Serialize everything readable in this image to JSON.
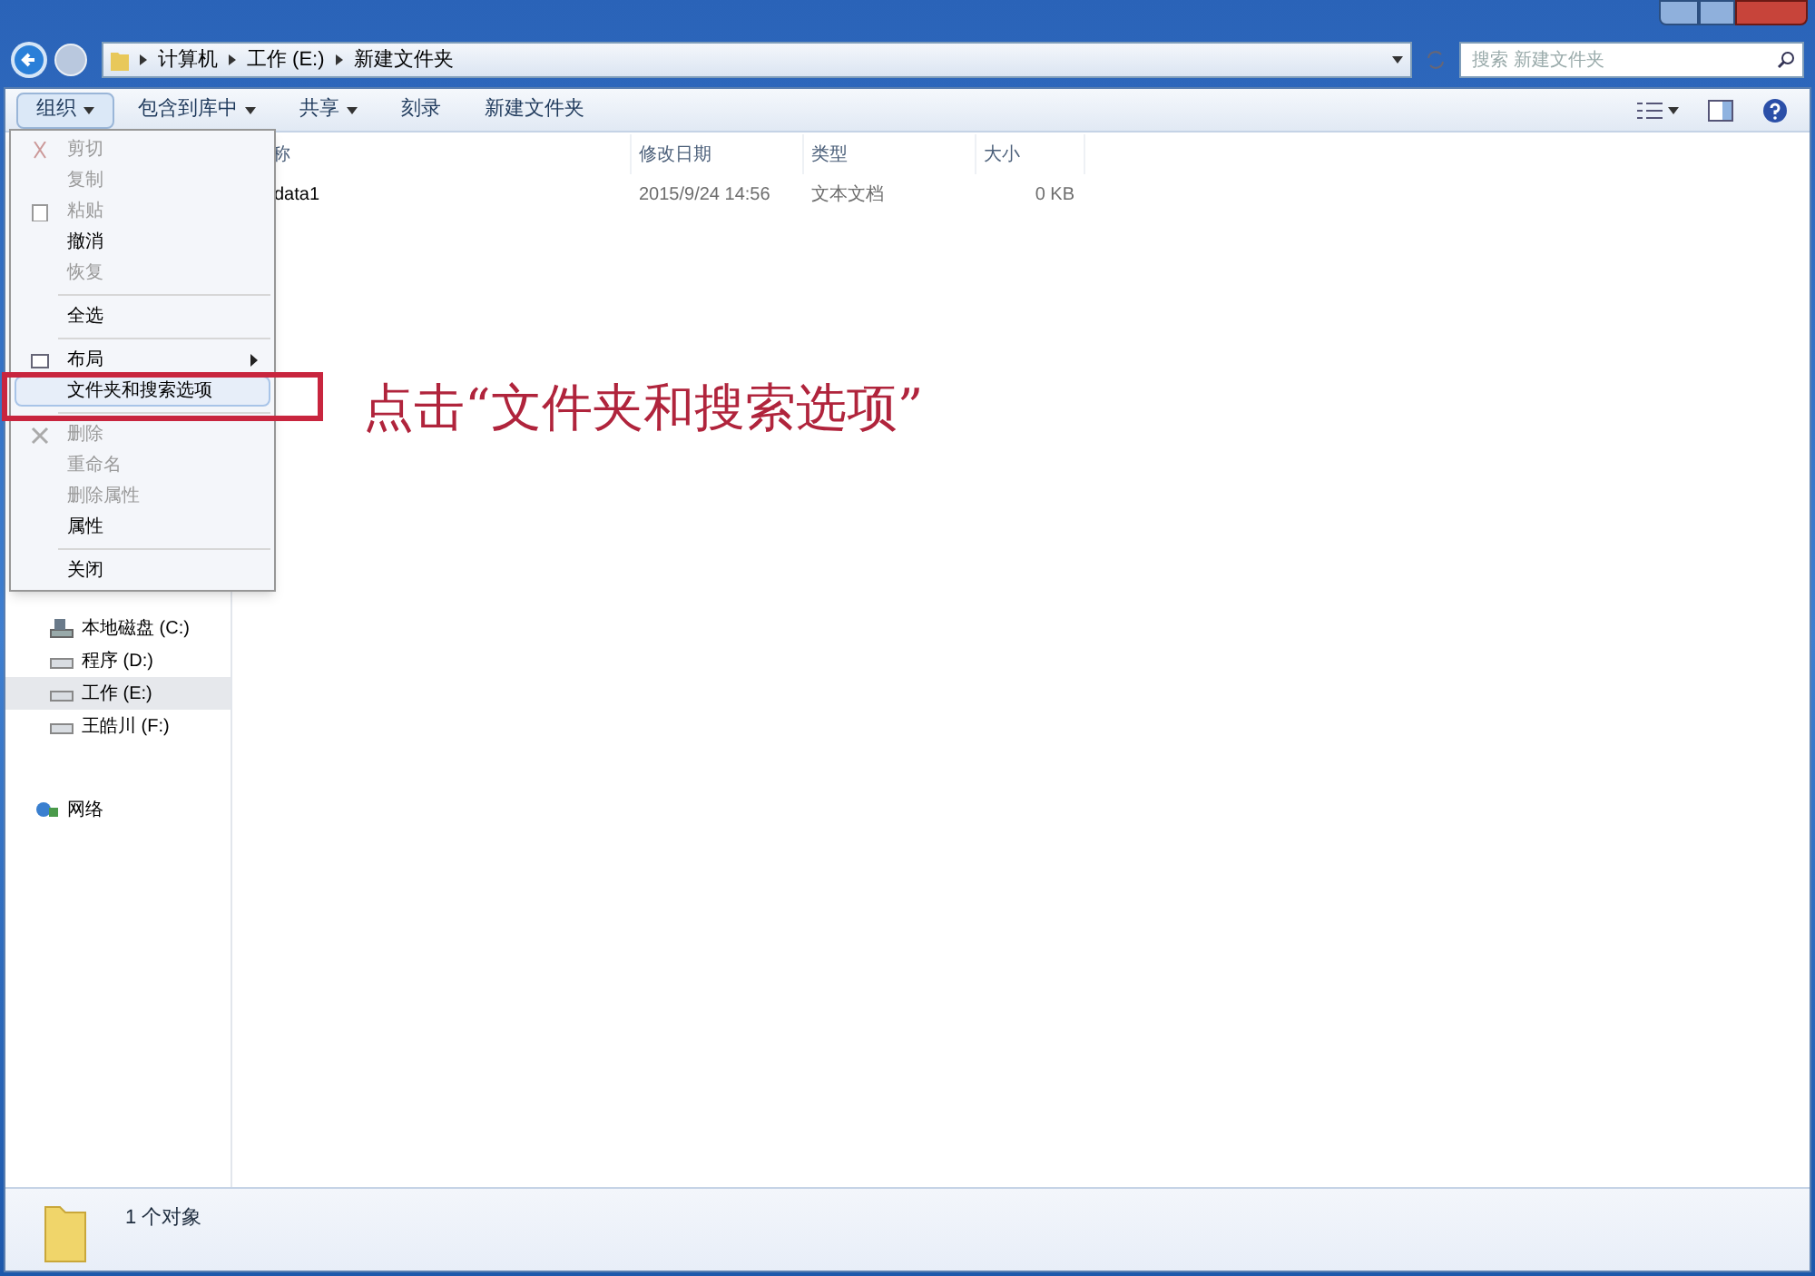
{
  "address_bar": {
    "crumbs": [
      "计算机",
      "工作 (E:)",
      "新建文件夹"
    ]
  },
  "search": {
    "placeholder": "搜索 新建文件夹"
  },
  "toolbar": [
    {
      "label": "组织",
      "dropdown": true,
      "selected": true
    },
    {
      "label": "包含到库中",
      "dropdown": true,
      "selected": false
    },
    {
      "label": "共享",
      "dropdown": true,
      "selected": false
    },
    {
      "label": "刻录",
      "dropdown": false,
      "selected": false
    },
    {
      "label": "新建文件夹",
      "dropdown": false,
      "selected": false
    }
  ],
  "table": {
    "columns": [
      "称",
      "修改日期",
      "类型",
      "大小"
    ],
    "rows": [
      {
        "name": "data1",
        "modified": "2015/9/24 14:56",
        "type": "文本文档",
        "size": "0 KB"
      }
    ]
  },
  "sidebar": {
    "items": [
      {
        "label": "本地磁盘 (C:)",
        "kind": "system-drive",
        "selected": false
      },
      {
        "label": "程序 (D:)",
        "kind": "drive",
        "selected": false
      },
      {
        "label": "工作 (E:)",
        "kind": "drive",
        "selected": true
      },
      {
        "label": "王皓川 (F:)",
        "kind": "drive",
        "selected": false
      },
      {
        "label": "网络",
        "kind": "network",
        "selected": false
      }
    ]
  },
  "menu": [
    {
      "kind": "item",
      "label": "剪切",
      "disabled": true,
      "selected": false,
      "submenu": false
    },
    {
      "kind": "item",
      "label": "复制",
      "disabled": true,
      "selected": false,
      "submenu": false
    },
    {
      "kind": "item",
      "label": "粘贴",
      "disabled": true,
      "selected": false,
      "submenu": false
    },
    {
      "kind": "item",
      "label": "撤消",
      "disabled": false,
      "selected": false,
      "submenu": false
    },
    {
      "kind": "item",
      "label": "恢复",
      "disabled": true,
      "selected": false,
      "submenu": false
    },
    {
      "kind": "separator"
    },
    {
      "kind": "item",
      "label": "全选",
      "disabled": false,
      "selected": false,
      "submenu": false
    },
    {
      "kind": "separator"
    },
    {
      "kind": "item",
      "label": "布局",
      "disabled": false,
      "selected": false,
      "submenu": true
    },
    {
      "kind": "item",
      "label": "文件夹和搜索选项",
      "disabled": false,
      "selected": true,
      "submenu": false
    },
    {
      "kind": "separator"
    },
    {
      "kind": "item",
      "label": "删除",
      "disabled": true,
      "selected": false,
      "submenu": false
    },
    {
      "kind": "item",
      "label": "重命名",
      "disabled": true,
      "selected": false,
      "submenu": false
    },
    {
      "kind": "item",
      "label": "删除属性",
      "disabled": true,
      "selected": false,
      "submenu": false
    },
    {
      "kind": "item",
      "label": "属性",
      "disabled": false,
      "selected": false,
      "submenu": false
    },
    {
      "kind": "separator"
    },
    {
      "kind": "item",
      "label": "关闭",
      "disabled": false,
      "selected": false,
      "submenu": false
    }
  ],
  "annotation": {
    "text": "点击“文件夹和搜索选项”"
  },
  "status_bar": {
    "text": "1 个对象"
  }
}
